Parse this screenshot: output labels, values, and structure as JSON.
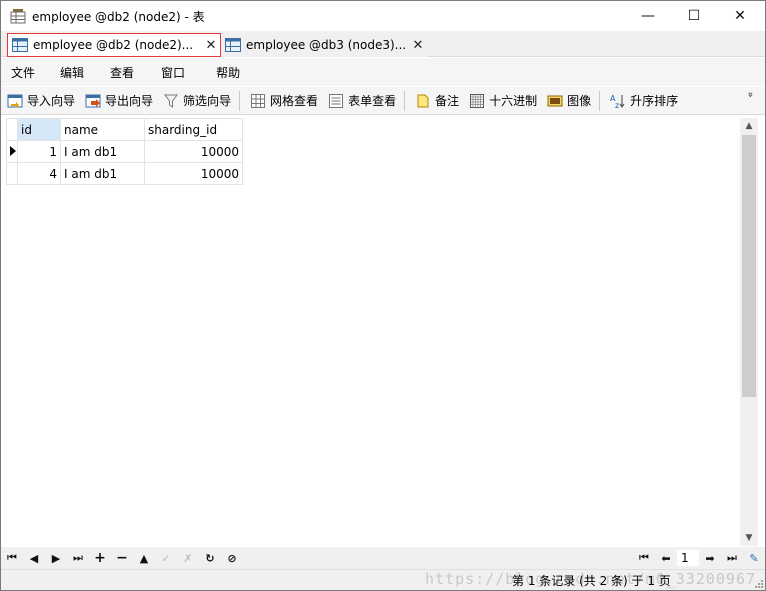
{
  "window": {
    "title": "employee @db2 (node2) - 表",
    "minimize_glyph": "—",
    "maximize_glyph": "☐",
    "close_glyph": "✕"
  },
  "tabs": [
    {
      "label": "employee @db2 (node2)...",
      "close": "✕",
      "active": true
    },
    {
      "label": "employee @db3 (node3)...",
      "close": "✕",
      "active": false
    }
  ],
  "menu": [
    "文件",
    "编辑",
    "查看",
    "窗口",
    "帮助"
  ],
  "toolbar": {
    "import_wizard": "导入向导",
    "export_wizard": "导出向导",
    "filter_wizard": "筛选向导",
    "grid_view": "网格查看",
    "form_view": "表单查看",
    "memo": "备注",
    "hex": "十六进制",
    "image": "图像",
    "sort_asc": "升序排序",
    "more": "»"
  },
  "grid": {
    "columns": [
      "id",
      "name",
      "sharding_id"
    ],
    "rows": [
      {
        "id": "1",
        "name": "I am db1",
        "sharding_id": "10000",
        "current": true
      },
      {
        "id": "4",
        "name": "I am db1",
        "sharding_id": "10000",
        "current": false
      }
    ]
  },
  "navigation": {
    "page_value": "1"
  },
  "status": {
    "text": "第 1 条记录 (共 2 条) 于 1 页",
    "watermark": "https://blog.csdn.net/m0_33200967"
  },
  "colors": {
    "active_tab_border": "#e53935",
    "header_selected": "#d6e8f7"
  },
  "icons": {
    "title": "table-icon",
    "tab": "table-icon"
  }
}
